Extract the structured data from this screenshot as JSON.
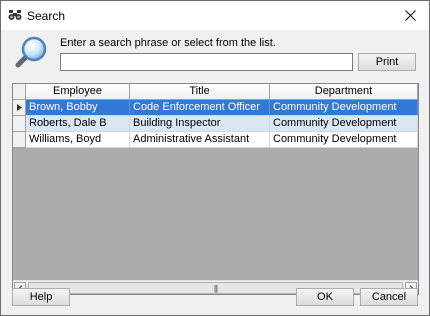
{
  "window": {
    "title": "Search",
    "icon": "binoculars-icon"
  },
  "prompt": "Enter a search phrase or select from the list.",
  "search": {
    "value": "",
    "placeholder": ""
  },
  "buttons": {
    "print": "Print",
    "help": "Help",
    "ok": "OK",
    "cancel": "Cancel"
  },
  "grid": {
    "columns": [
      "Employee",
      "Title",
      "Department"
    ],
    "rows": [
      [
        "Brown, Bobby",
        "Code Enforcement Officer",
        "Community Development"
      ],
      [
        "Roberts, Dale B",
        "Building Inspector",
        "Community Development"
      ],
      [
        "Williams, Boyd",
        "Administrative Assistant",
        "Community Development"
      ]
    ],
    "selected_row": 0
  },
  "scrollbar": {
    "thumb_grip": "|||"
  },
  "colors": {
    "selection": "#3478d6",
    "alt_row": "#dbe6f5"
  }
}
